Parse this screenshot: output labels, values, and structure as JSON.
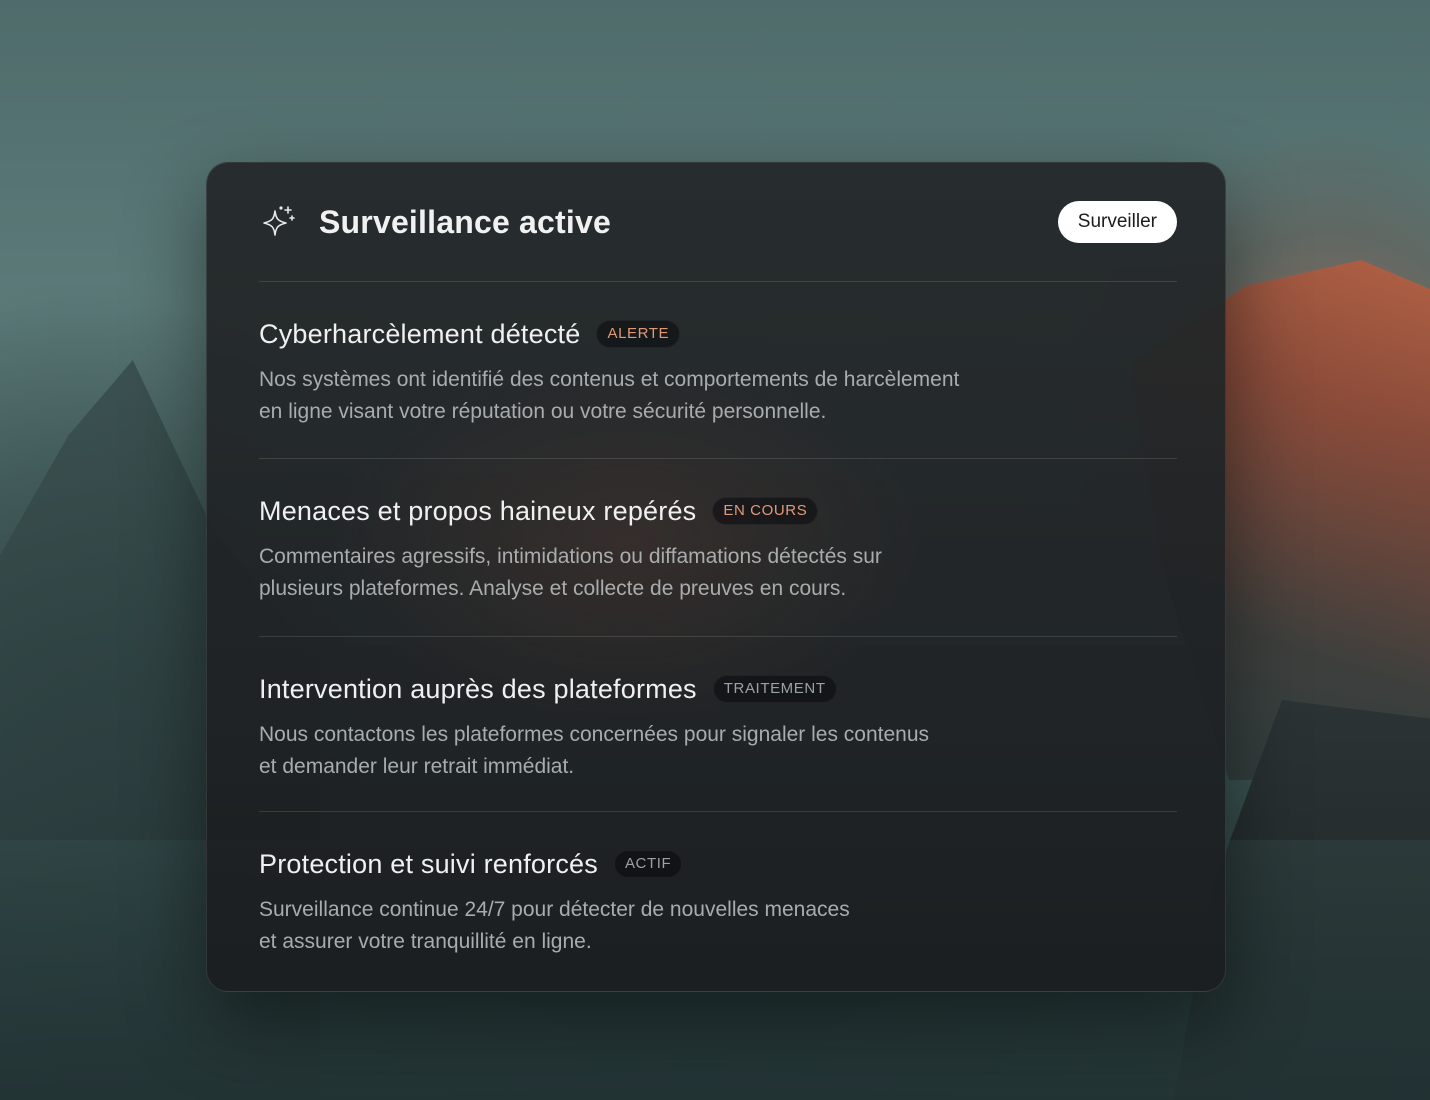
{
  "colors": {
    "card_background": "#24282a",
    "title_text": "#f1f1f1",
    "body_text": "#a9acad",
    "badge_warning": "#e09a78",
    "badge_neutral": "#9aa3a3",
    "button_background": "#ffffff",
    "button_text": "#1c1c1c"
  },
  "header": {
    "icon": "sparkles-icon",
    "title": "Surveillance active",
    "button_label": "Surveiller"
  },
  "items": [
    {
      "title": "Cyberharcèlement détecté",
      "badge": "ALERTE",
      "description": "Nos systèmes ont identifié des contenus et comportements de harcèlement\nen ligne visant votre réputation ou votre sécurité personnelle."
    },
    {
      "title": "Menaces et propos haineux repérés",
      "badge": "EN COURS",
      "description": "Commentaires agressifs, intimidations ou diffamations détectés sur\nplusieurs plateformes. Analyse et collecte de preuves en cours."
    },
    {
      "title": "Intervention auprès des plateformes",
      "badge": "TRAITEMENT",
      "description": "Nous contactons les plateformes concernées pour signaler les contenus\net demander leur retrait immédiat."
    },
    {
      "title": "Protection et suivi renforcés",
      "badge": "ACTIF",
      "description": "Surveillance continue 24/7 pour détecter de nouvelles menaces\net assurer votre tranquillité en ligne."
    }
  ]
}
